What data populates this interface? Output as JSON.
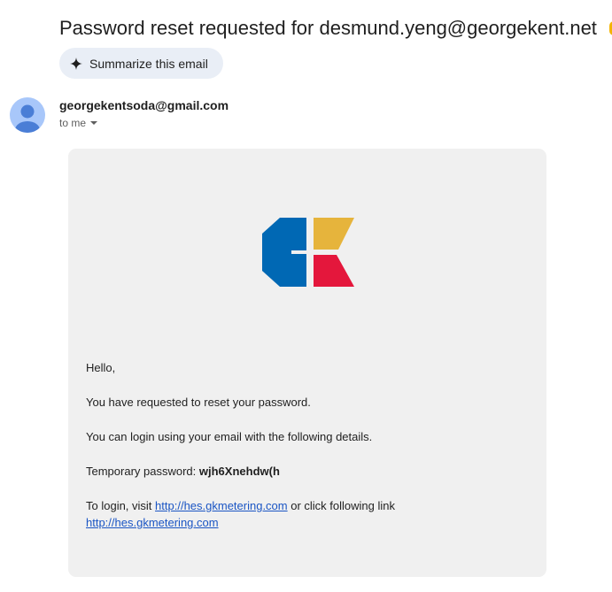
{
  "email": {
    "subject": "Password reset requested for desmund.yeng@georgekent.net",
    "summarize_label": "Summarize this email",
    "sender": "georgekentsoda@gmail.com",
    "recipient_label": "to me",
    "body": {
      "greeting": "Hello,",
      "line1": "You have requested to reset your password.",
      "line2": "You can login using your email with the following details.",
      "password_label": "Temporary password: ",
      "password_value": "wjh6Xnehdw(h",
      "login_prefix": "To login, visit ",
      "login_link": "http://hes.gkmetering.com",
      "login_middle": " or click following link",
      "login_link2": "http://hes.gkmetering.com"
    }
  },
  "icons": {
    "summarize": "sparkle-icon",
    "caret": "chevron-down-icon",
    "avatar": "person-icon",
    "logo": "company-logo"
  },
  "colors": {
    "summarize_bg": "#e9eef6",
    "card_bg": "#f0f0f0",
    "link": "#1a55c4",
    "logo_blue": "#0068b4",
    "logo_yellow": "#e6b43c",
    "logo_red": "#e4173c"
  }
}
